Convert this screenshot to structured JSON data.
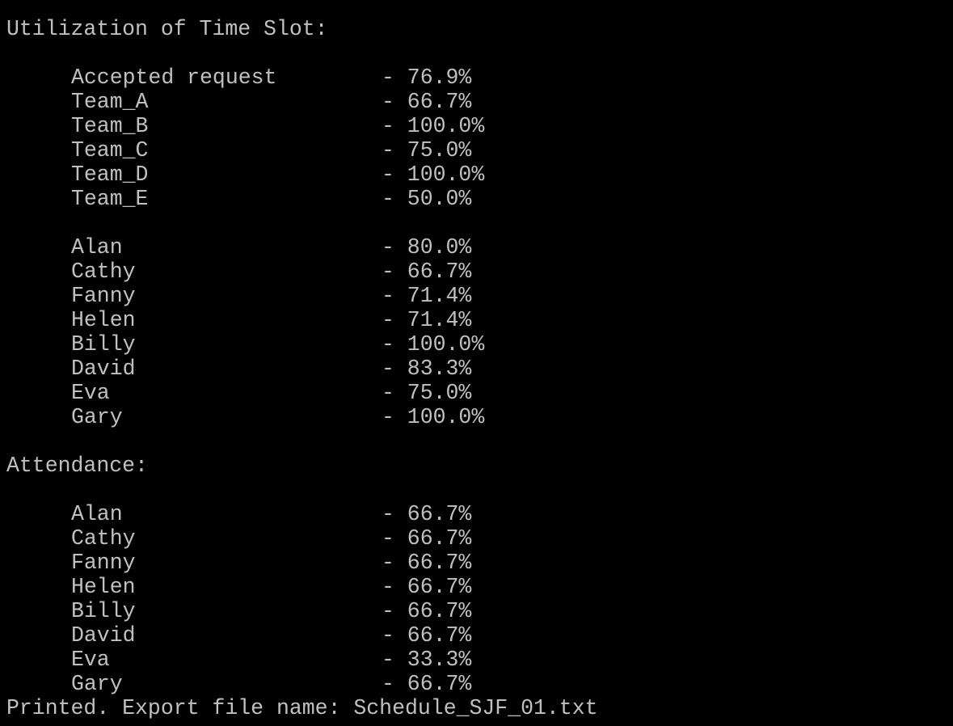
{
  "terminal": {
    "background": "#000000",
    "foreground": "#c0c0c0",
    "utilization": {
      "heading": "Utilization of Time Slot:",
      "teams": [
        {
          "name": "Accepted request",
          "value": "- 76.9%"
        },
        {
          "name": "Team_A",
          "value": "- 66.7%"
        },
        {
          "name": "Team_B",
          "value": "- 100.0%"
        },
        {
          "name": "Team_C",
          "value": "- 75.0%"
        },
        {
          "name": "Team_D",
          "value": "- 100.0%"
        },
        {
          "name": "Team_E",
          "value": "- 50.0%"
        }
      ],
      "people": [
        {
          "name": "Alan",
          "value": "- 80.0%"
        },
        {
          "name": "Cathy",
          "value": "- 66.7%"
        },
        {
          "name": "Fanny",
          "value": "- 71.4%"
        },
        {
          "name": "Helen",
          "value": "- 71.4%"
        },
        {
          "name": "Billy",
          "value": "- 100.0%"
        },
        {
          "name": "David",
          "value": "- 83.3%"
        },
        {
          "name": "Eva",
          "value": "- 75.0%"
        },
        {
          "name": "Gary",
          "value": "- 100.0%"
        }
      ]
    },
    "attendance": {
      "heading": "Attendance:",
      "people": [
        {
          "name": "Alan",
          "value": "- 66.7%"
        },
        {
          "name": "Cathy",
          "value": "- 66.7%"
        },
        {
          "name": "Fanny",
          "value": "- 66.7%"
        },
        {
          "name": "Helen",
          "value": "- 66.7%"
        },
        {
          "name": "Billy",
          "value": "- 66.7%"
        },
        {
          "name": "David",
          "value": "- 66.7%"
        },
        {
          "name": "Eva",
          "value": "- 33.3%"
        },
        {
          "name": "Gary",
          "value": "- 66.7%"
        }
      ]
    },
    "footer": "Printed. Export file name: Schedule_SJF_01.txt"
  }
}
